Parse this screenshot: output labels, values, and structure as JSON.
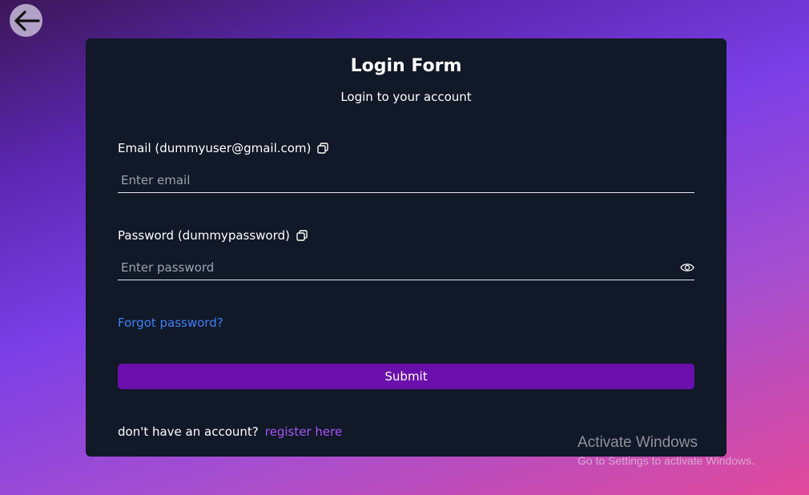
{
  "nav": {
    "back_icon": "arrow-left-icon"
  },
  "form": {
    "title": "Login Form",
    "subtitle": "Login to your account",
    "email": {
      "label": "Email (dummyuser@gmail.com)",
      "placeholder": "Enter email",
      "value": "",
      "copy_icon": "copy-icon"
    },
    "password": {
      "label": "Password (dummypassword)",
      "placeholder": "Enter password",
      "value": "",
      "copy_icon": "copy-icon",
      "toggle_icon": "eye-icon"
    },
    "forgot_label": "Forgot password?",
    "submit_label": "Submit",
    "register_prompt": "don't have an account?",
    "register_label": "register here"
  },
  "watermark": {
    "line1": "Activate Windows",
    "line2": "Go to Settings to activate Windows."
  },
  "colors": {
    "card_bg": "#111827",
    "submit_bg": "#6b0fac",
    "link_blue": "#3b82f6",
    "link_purple": "#a855f7"
  }
}
